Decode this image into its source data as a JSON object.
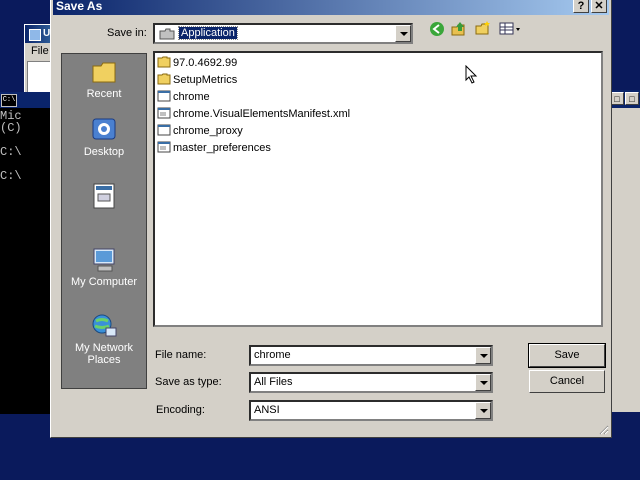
{
  "background": {
    "notepad": {
      "title": "U",
      "menu": "File"
    },
    "cmd": {
      "icon_text": "C:\\",
      "lines": [
        "Mic",
        "(C)",
        "",
        "C:\\",
        "",
        "C:\\"
      ]
    },
    "right_window": {
      "button1": "□",
      "button2": "□"
    }
  },
  "dialog": {
    "title": "Save As",
    "help_button": "?",
    "close_button": "✕",
    "save_in_label": "Save in:",
    "save_in_value": "Application",
    "places": [
      {
        "label": "Recent",
        "icon": "recent-folder-icon"
      },
      {
        "label": "Desktop",
        "icon": "desktop-icon"
      },
      {
        "label": "",
        "icon": "documents-icon"
      },
      {
        "label": "My Computer",
        "icon": "my-computer-icon"
      },
      {
        "label": "My Network Places",
        "icon": "network-places-icon"
      }
    ],
    "files": [
      {
        "name": "97.0.4692.99",
        "type": "folder"
      },
      {
        "name": "SetupMetrics",
        "type": "folder"
      },
      {
        "name": "chrome",
        "type": "file"
      },
      {
        "name": "chrome.VisualElementsManifest.xml",
        "type": "xml"
      },
      {
        "name": "chrome_proxy",
        "type": "file"
      },
      {
        "name": "master_preferences",
        "type": "xml"
      }
    ],
    "file_name_label": "File name:",
    "file_name_value": "chrome",
    "save_as_type_label": "Save as type:",
    "save_as_type_value": "All Files",
    "encoding_label": "Encoding:",
    "encoding_value": "ANSI",
    "save_button": "Save",
    "cancel_button": "Cancel"
  },
  "colors": {
    "desktop": "#0a1a5c",
    "title_active": "#0a246a",
    "face": "#d4d0c8",
    "places_bar": "#808080"
  }
}
